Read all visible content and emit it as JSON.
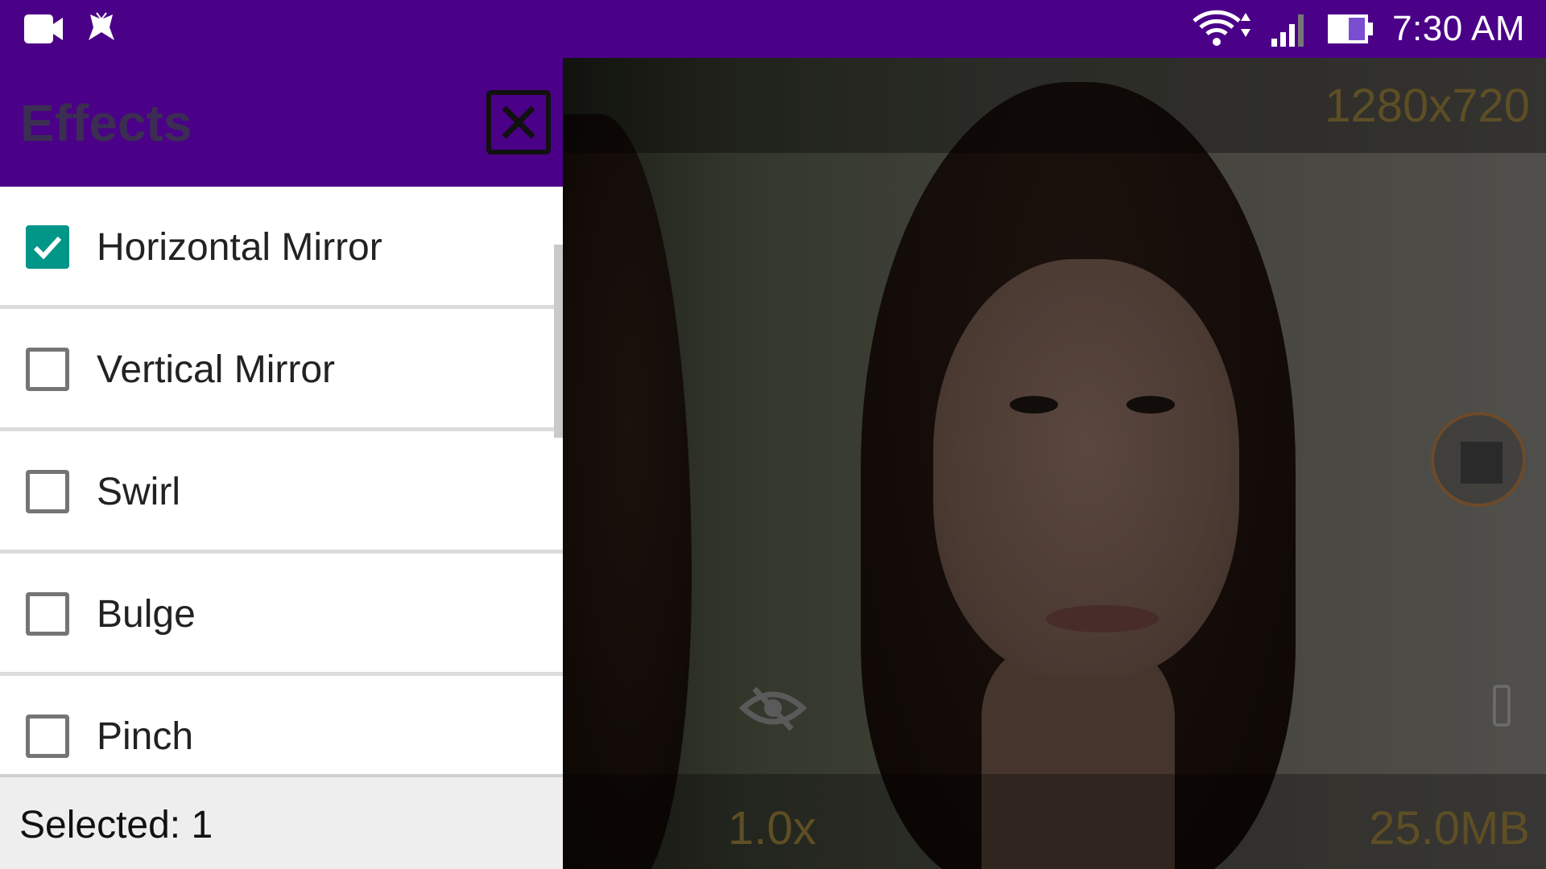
{
  "status_bar": {
    "left_icons": [
      "video-camera-icon",
      "butterfly-app-icon"
    ],
    "right_icons": [
      "wifi-icon",
      "signal-icon",
      "battery-icon"
    ],
    "time": "7:30 AM",
    "background": "#4b0088"
  },
  "drawer": {
    "title": "Effects",
    "close_icon": "close-icon",
    "items": [
      {
        "label": "Horizontal Mirror",
        "checked": true
      },
      {
        "label": "Vertical Mirror",
        "checked": false
      },
      {
        "label": "Swirl",
        "checked": false
      },
      {
        "label": "Bulge",
        "checked": false
      },
      {
        "label": "Pinch",
        "checked": false
      }
    ],
    "footer": "Selected: 1",
    "accent": "#009688"
  },
  "camera": {
    "resolution": "1280x720",
    "zoom": "1.0x",
    "file_size": "25.0MB",
    "stop_icon": "stop-record-icon",
    "visibility_icon": "eye-off-icon"
  }
}
